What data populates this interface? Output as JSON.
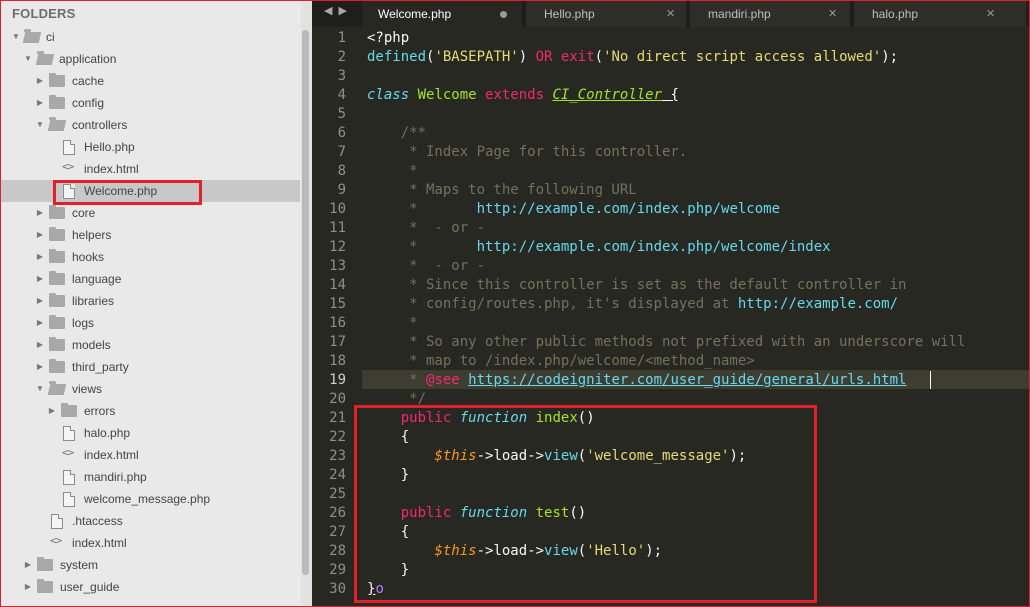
{
  "sidebar": {
    "title": "FOLDERS",
    "items": [
      {
        "label": "ci",
        "type": "folder-open"
      },
      {
        "label": "application",
        "type": "folder-open"
      },
      {
        "label": "cache",
        "type": "folder"
      },
      {
        "label": "config",
        "type": "folder"
      },
      {
        "label": "controllers",
        "type": "folder-open"
      },
      {
        "label": "Hello.php",
        "type": "file"
      },
      {
        "label": "index.html",
        "type": "code"
      },
      {
        "label": "Welcome.php",
        "type": "file"
      },
      {
        "label": "core",
        "type": "folder"
      },
      {
        "label": "helpers",
        "type": "folder"
      },
      {
        "label": "hooks",
        "type": "folder"
      },
      {
        "label": "language",
        "type": "folder"
      },
      {
        "label": "libraries",
        "type": "folder"
      },
      {
        "label": "logs",
        "type": "folder"
      },
      {
        "label": "models",
        "type": "folder"
      },
      {
        "label": "third_party",
        "type": "folder"
      },
      {
        "label": "views",
        "type": "folder-open"
      },
      {
        "label": "errors",
        "type": "folder"
      },
      {
        "label": "halo.php",
        "type": "file"
      },
      {
        "label": "index.html",
        "type": "code"
      },
      {
        "label": "mandiri.php",
        "type": "file"
      },
      {
        "label": "welcome_message.php",
        "type": "file"
      },
      {
        "label": ".htaccess",
        "type": "file"
      },
      {
        "label": "index.html",
        "type": "code"
      },
      {
        "label": "system",
        "type": "folder"
      },
      {
        "label": "user_guide",
        "type": "folder"
      }
    ]
  },
  "tabs": [
    {
      "label": "Welcome.php",
      "active": true
    },
    {
      "label": "Hello.php",
      "active": false
    },
    {
      "label": "mandiri.php",
      "active": false
    },
    {
      "label": "halo.php",
      "active": false
    }
  ],
  "editor": {
    "current_line": 19,
    "line_numbers": [
      "1",
      "2",
      "3",
      "4",
      "5",
      "6",
      "7",
      "8",
      "9",
      "10",
      "11",
      "12",
      "13",
      "14",
      "15",
      "16",
      "17",
      "18",
      "19",
      "20",
      "21",
      "22",
      "23",
      "24",
      "25",
      "26",
      "27",
      "28",
      "29",
      "30"
    ],
    "lines": {
      "l1": "<?php",
      "l2a": "defined",
      "l2b": "(",
      "l2c": "'BASEPATH'",
      "l2d": ") ",
      "l2e": "OR",
      "l2f": " ",
      "l2g": "exit",
      "l2h": "(",
      "l2i": "'No direct script access allowed'",
      "l2j": ");",
      "l4a": "class",
      "l4b": " Welcome ",
      "l4c": "extends",
      "l4d": " ",
      "l4e": "CI_Controller",
      "l4f": " {",
      "l6": "    /**",
      "l7": "     * Index Page for this controller.",
      "l8": "     *",
      "l9": "     * Maps to the following URL",
      "l10a": "     *       ",
      "l10b": "http://example.com/index.php/welcome",
      "l11": "     *  - or -",
      "l12a": "     *       ",
      "l12b": "http://example.com/index.php/welcome/index",
      "l13": "     *  - or -",
      "l14": "     * Since this controller is set as the default controller in",
      "l15a": "     * config/routes.php, it's displayed at ",
      "l15b": "http://example.com/",
      "l16": "     *",
      "l17": "     * So any other public methods not prefixed with an underscore will",
      "l18": "     * map to /index.php/welcome/<method_name>",
      "l19a": "     * ",
      "l19b": "@see",
      "l19c": " ",
      "l19d": "https://codeigniter.com/user_guide/general/urls.html",
      "l20": "     */",
      "l21a": "    public",
      "l21b": " ",
      "l21c": "function",
      "l21d": " ",
      "l21e": "index",
      "l21f": "()",
      "l22": "    {",
      "l23a": "        ",
      "l23b": "$this",
      "l23c": "->load->",
      "l23d": "view",
      "l23e": "(",
      "l23f": "'welcome_message'",
      "l23g": ");",
      "l24": "    }",
      "l26a": "    public",
      "l26b": " ",
      "l26c": "function",
      "l26d": " ",
      "l26e": "test",
      "l26f": "()",
      "l27": "    {",
      "l28a": "        ",
      "l28b": "$this",
      "l28c": "->load->",
      "l28d": "view",
      "l28e": "(",
      "l28f": "'Hello'",
      "l28g": ");",
      "l29": "    }",
      "l30a": "}",
      "l30b": "o"
    }
  },
  "colors": {
    "bg": "#272822",
    "keyword": "#f92672",
    "type": "#66d9ef",
    "string": "#e6db74",
    "comment": "#75715e",
    "highlight": "#e0202a"
  }
}
